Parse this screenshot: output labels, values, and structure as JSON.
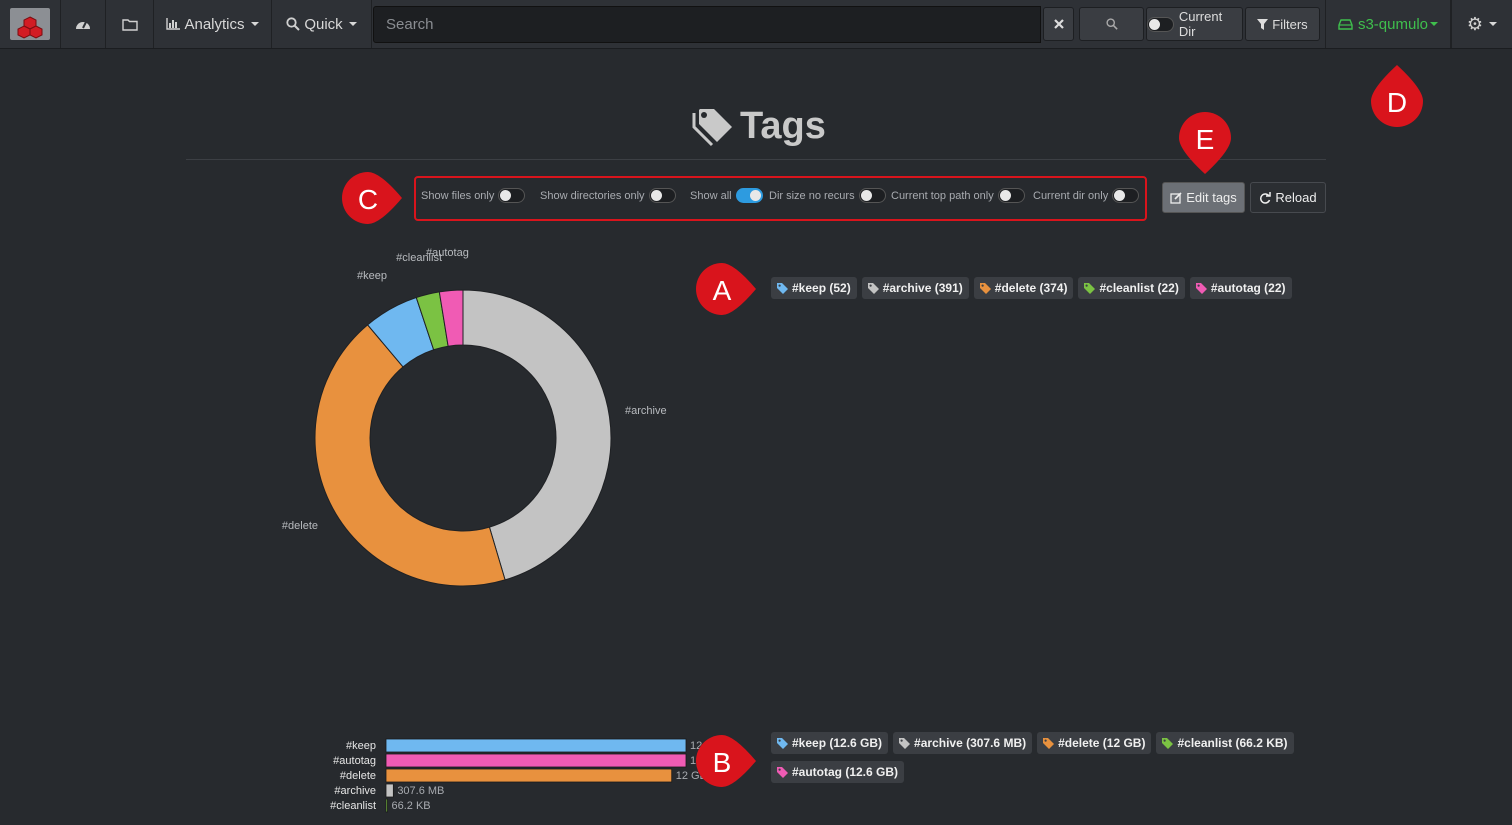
{
  "navbar": {
    "analytics_label": "Analytics",
    "quick_label": "Quick",
    "search_placeholder": "Search",
    "current_dir_label": "Current Dir",
    "filters_label": "Filters",
    "index_label": "s3-qumulo"
  },
  "page": {
    "title": "Tags"
  },
  "options": [
    {
      "label": "Show files only",
      "on": false
    },
    {
      "label": "Show directories only",
      "on": false
    },
    {
      "label": "Show all",
      "on": true
    },
    {
      "label": "Dir size no recurs",
      "on": false
    },
    {
      "label": "Current top path only",
      "on": false
    },
    {
      "label": "Current dir only",
      "on": false
    }
  ],
  "buttons": {
    "edit_tags": "Edit tags",
    "reload": "Reload"
  },
  "colors": {
    "keep": "#6fb8f0",
    "archive": "#c3c3c3",
    "delete": "#e8913e",
    "cleanlist": "#7bc243",
    "autotag": "#f05bb4",
    "callout": "#d9141c"
  },
  "count_pills": [
    {
      "label": "#keep (52)",
      "color": "#6fb8f0"
    },
    {
      "label": "#archive (391)",
      "color": "#c3c3c3"
    },
    {
      "label": "#delete (374)",
      "color": "#e8913e"
    },
    {
      "label": "#cleanlist (22)",
      "color": "#7bc243"
    },
    {
      "label": "#autotag (22)",
      "color": "#f05bb4"
    }
  ],
  "size_pills": [
    {
      "label": "#keep (12.6 GB)",
      "color": "#6fb8f0"
    },
    {
      "label": "#archive (307.6 MB)",
      "color": "#c3c3c3"
    },
    {
      "label": "#delete (12 GB)",
      "color": "#e8913e"
    },
    {
      "label": "#cleanlist (66.2 KB)",
      "color": "#7bc243"
    },
    {
      "label": "#autotag (12.6 GB)",
      "color": "#f05bb4"
    }
  ],
  "callouts": {
    "a": "A",
    "b": "B",
    "c": "C",
    "d": "D",
    "e": "E"
  },
  "chart_data": [
    {
      "type": "pie",
      "title": "",
      "categories": [
        "#archive",
        "#delete",
        "#keep",
        "#cleanlist",
        "#autotag"
      ],
      "values": [
        391,
        374,
        52,
        22,
        22
      ],
      "colors": [
        "#c3c3c3",
        "#e8913e",
        "#6fb8f0",
        "#7bc243",
        "#f05bb4"
      ]
    },
    {
      "type": "bar",
      "title": "",
      "categories": [
        "#keep",
        "#autotag",
        "#delete",
        "#archive",
        "#cleanlist"
      ],
      "values": [
        12.6,
        12.6,
        12,
        0.3076,
        6.62e-05
      ],
      "unit": "GB",
      "value_labels": [
        "12.6 GB",
        "12.6 GB",
        "12 GB",
        "307.6 MB",
        "66.2 KB"
      ],
      "colors": [
        "#6fb8f0",
        "#f05bb4",
        "#e8913e",
        "#c3c3c3",
        "#7bc243"
      ]
    }
  ]
}
